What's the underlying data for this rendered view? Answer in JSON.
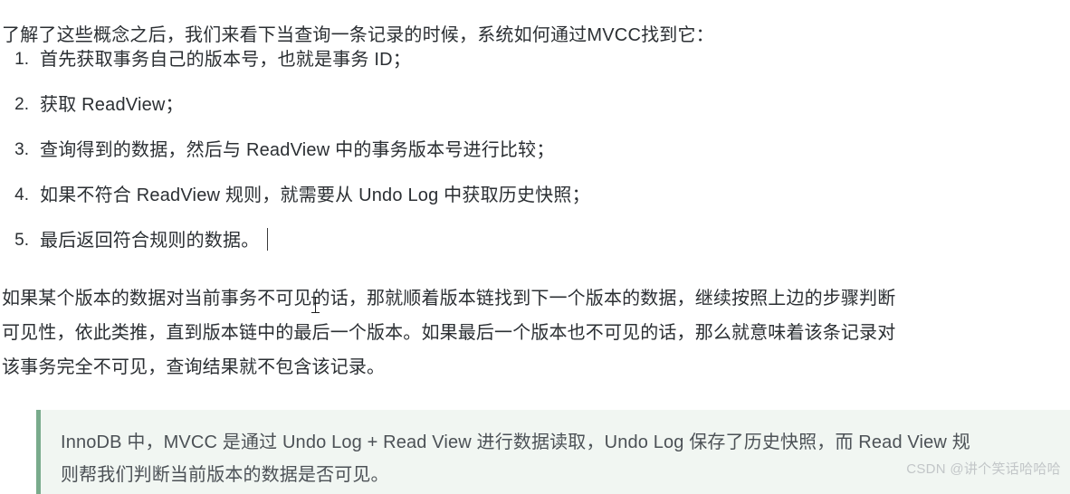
{
  "article": {
    "intro": "了解了这些概念之后，我们来看下当查询一条记录的时候，系统如何通过MVCC找到它：",
    "steps": [
      {
        "marker": "1.",
        "text": "首先获取事务自己的版本号，也就是事务 ID；"
      },
      {
        "marker": "2.",
        "text": "获取 ReadView；"
      },
      {
        "marker": "3.",
        "text": "查询得到的数据，然后与 ReadView 中的事务版本号进行比较；"
      },
      {
        "marker": "4.",
        "text": "如果不符合 ReadView 规则，就需要从 Undo Log 中获取历史快照；"
      },
      {
        "marker": "5.",
        "text": "最后返回符合规则的数据。"
      }
    ],
    "paragraph_lines": [
      "如果某个版本的数据对当前事务不可见的话，那就顺着版本链找到下一个版本的数据，继续按照上边的步骤判断",
      "可见性，依此类推，直到版本链中的最后一个版本。如果最后一个版本也不可见的话，那么就意味着该条记录对",
      "该事务完全不可见，查询结果就不包含该记录。"
    ]
  },
  "callout": {
    "lines": [
      "InnoDB 中，MVCC 是通过 Undo Log + Read View 进行数据读取，Undo Log 保存了历史快照，而 Read View 规",
      "则帮我们判断当前版本的数据是否可见。"
    ],
    "accent_color": "#79ab8c",
    "background_color": "#f1f6f2"
  },
  "watermark": {
    "text": "CSDN @讲个笑话哈哈哈"
  }
}
